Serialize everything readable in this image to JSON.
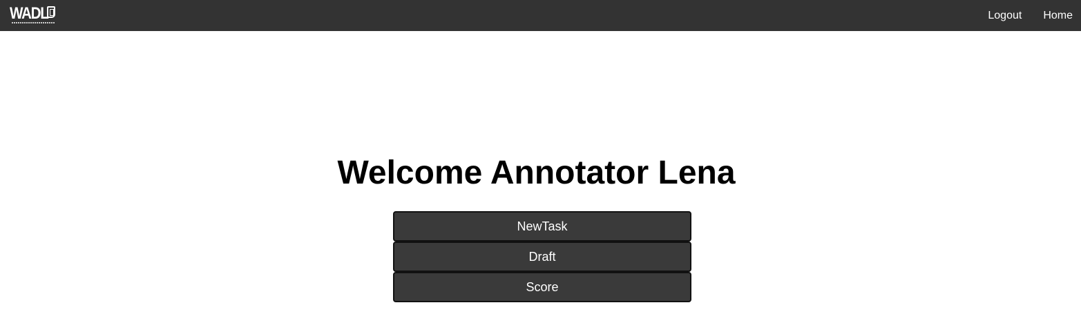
{
  "navbar": {
    "logo_text": "WADL",
    "links": [
      {
        "label": "Logout"
      },
      {
        "label": "Home"
      }
    ]
  },
  "main": {
    "welcome_title": "Welcome Annotator Lena",
    "buttons": [
      {
        "label": "NewTask"
      },
      {
        "label": "Draft"
      },
      {
        "label": "Score"
      }
    ]
  },
  "colors": {
    "navbar_bg": "#333333",
    "button_bg": "#3a3a3a",
    "button_border": "#111111",
    "text_light": "#ffffff"
  }
}
